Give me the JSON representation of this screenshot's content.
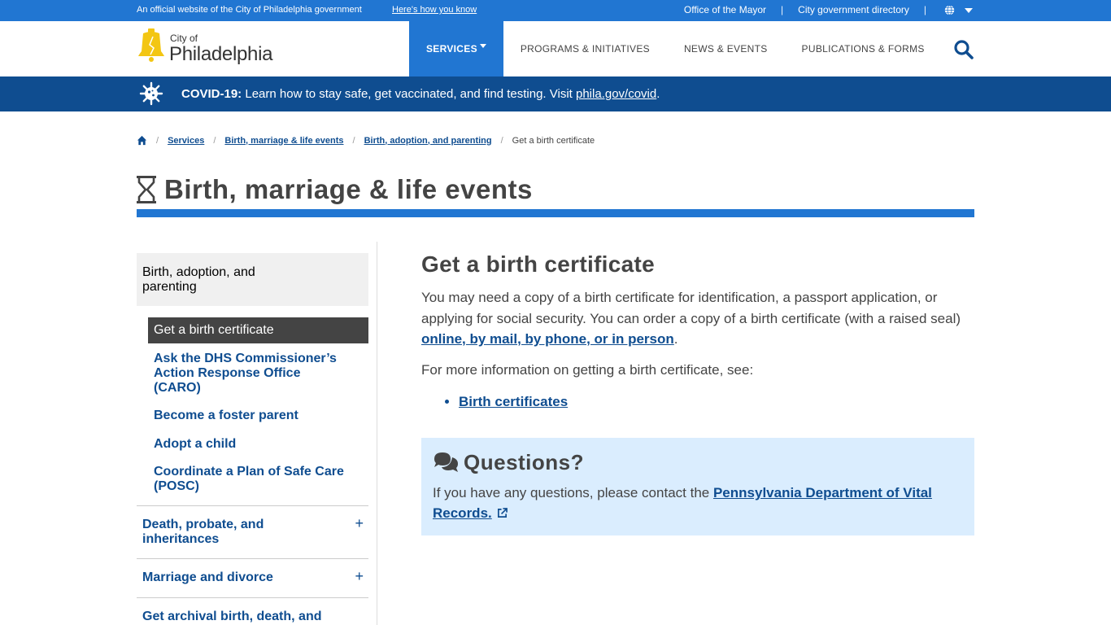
{
  "topbar": {
    "official": "An official website of the City of Philadelphia government",
    "how_know": "Here's how you know",
    "links": [
      "Office of the Mayor",
      "City government directory"
    ],
    "sep": "|"
  },
  "header": {
    "logo_city_of": "City of",
    "logo_name": "Philadelphia",
    "nav": [
      "SERVICES",
      "PROGRAMS & INITIATIVES",
      "NEWS & EVENTS",
      "PUBLICATIONS & FORMS"
    ]
  },
  "covid": {
    "label": "COVID-19:",
    "message": "Learn how to stay safe, get vaccinated, and find testing. Visit",
    "link": "phila.gov/covid",
    "end": "."
  },
  "breadcrumb": {
    "items": [
      "Services",
      "Birth, marriage & life events",
      "Birth, adoption, and parenting"
    ],
    "current": "Get a birth certificate",
    "sep": "/"
  },
  "page": {
    "title": "Birth, marriage & life events"
  },
  "sidebar": {
    "parent": "Birth, adoption, and parenting",
    "active": "Get a birth certificate",
    "sub_items": [
      "Ask the DHS Commissioner’s Action Response Office (CARO)",
      "Become a foster parent",
      "Adopt a child",
      "Coordinate a Plan of Safe Care (POSC)"
    ],
    "sections": [
      "Death, probate, and inheritances",
      "Marriage and divorce",
      "Get archival birth, death, and"
    ],
    "plus": "+"
  },
  "main": {
    "heading": "Get a birth certificate",
    "intro": "You may need a copy of a birth certificate for identification, a passport application, or applying for social security. You can order a copy of a birth certificate (with a raised seal)",
    "intro_link": "online, by mail, by phone, or in person",
    "intro_end": ".",
    "more_info": "For more information on getting a birth certificate, see:",
    "list": [
      "Birth certificates"
    ]
  },
  "questions": {
    "title": "Questions?",
    "text": "If you have any questions, please contact the",
    "link": "Pennsylvania Department of Vital Records."
  },
  "colors": {
    "brand_blue": "#2176d2",
    "dark_blue": "#0f4d90",
    "logo_gold": "#f3c613",
    "callout_bg": "#daedfe"
  }
}
